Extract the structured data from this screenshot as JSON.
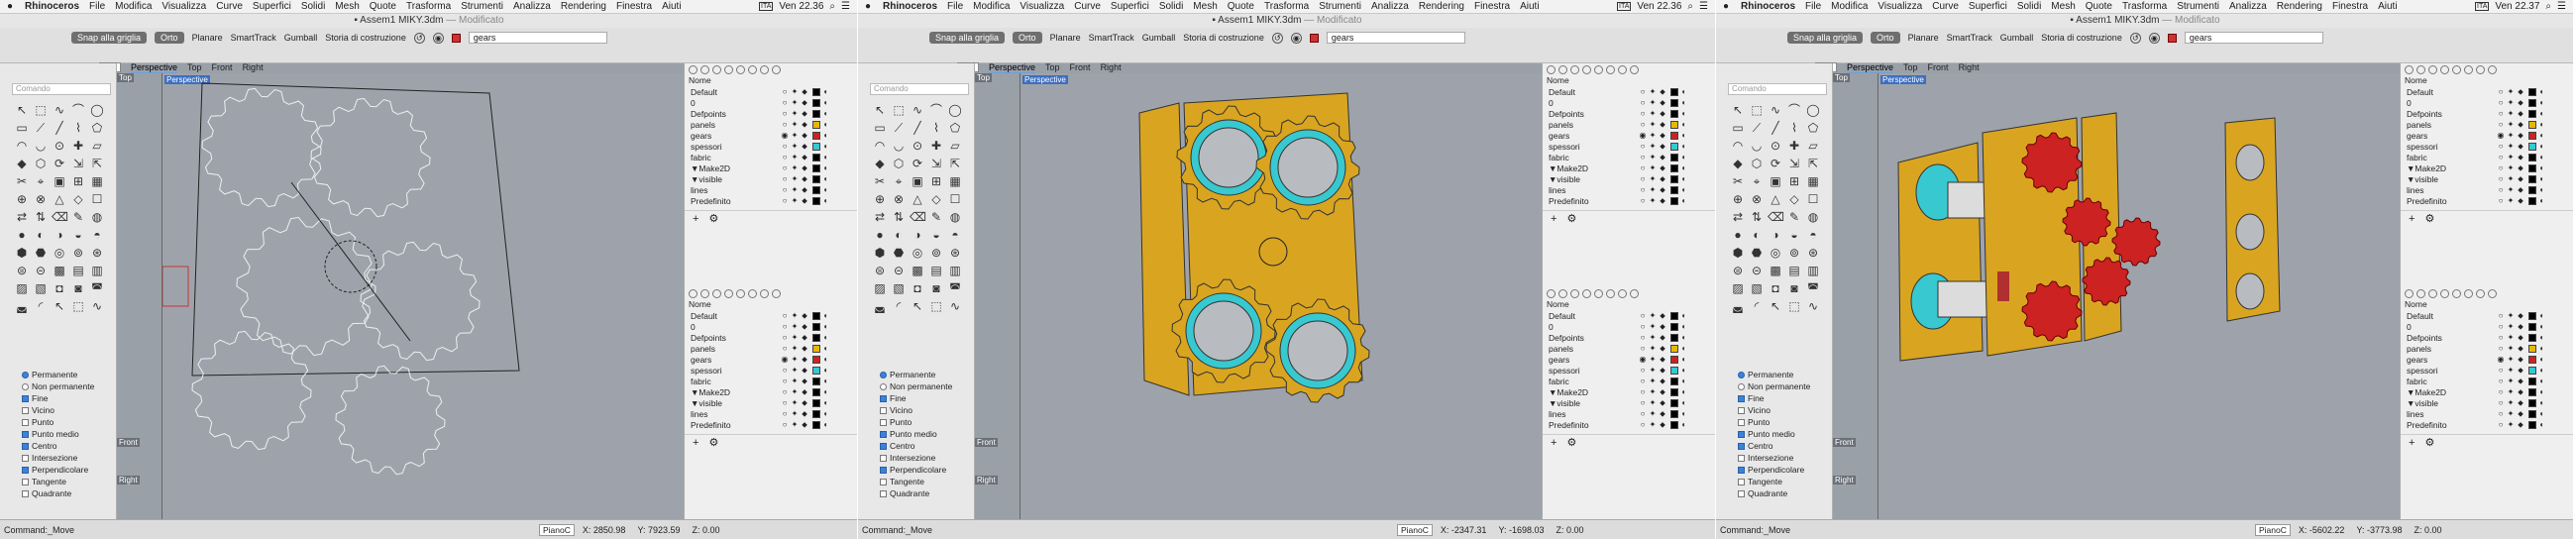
{
  "menubar": {
    "apple": "",
    "items": [
      "Rhinoceros",
      "File",
      "Modifica",
      "Visualizza",
      "Curve",
      "Superfici",
      "Solidi",
      "Mesh",
      "Quote",
      "Trasforma",
      "Strumenti",
      "Analizza",
      "Rendering",
      "Finestra",
      "Aiuti"
    ],
    "input_badge": "ITA"
  },
  "toolbar": {
    "snap_grid": "Snap alla griglia",
    "orto": "Orto",
    "planare": "Planare",
    "smarttrack": "SmartTrack",
    "gumball": "Gumball",
    "storia": "Storia di costruzione",
    "layer_current": "gears"
  },
  "viewport_tabs": [
    "Perspective",
    "Top",
    "Front",
    "Right"
  ],
  "viewports": {
    "perspective": "Perspective",
    "top": "Top",
    "front": "Front",
    "right": "Right"
  },
  "command_placeholder": "Comando",
  "osnap": {
    "permanente": "Permanente",
    "non_permanente": "Non permanente",
    "items": [
      {
        "label": "Fine",
        "on": true
      },
      {
        "label": "Vicino",
        "on": false
      },
      {
        "label": "Punto",
        "on": false
      },
      {
        "label": "Punto medio",
        "on": true
      },
      {
        "label": "Centro",
        "on": true
      },
      {
        "label": "Intersezione",
        "on": false
      },
      {
        "label": "Perpendicolare",
        "on": true
      },
      {
        "label": "Tangente",
        "on": false
      },
      {
        "label": "Quadrante",
        "on": false
      }
    ]
  },
  "layers": {
    "header": "Nome",
    "rows": [
      {
        "name": "Default",
        "color": "#000000"
      },
      {
        "name": "0",
        "color": "#000000"
      },
      {
        "name": "Defpoints",
        "color": "#000000"
      },
      {
        "name": "panels",
        "color": "#e8b800"
      },
      {
        "name": "gears",
        "color": "#cc2222"
      },
      {
        "name": "spessori",
        "color": "#38c8d0"
      },
      {
        "name": "fabric",
        "color": "#000000"
      },
      {
        "name": "▼Make2D",
        "color": "#000000"
      },
      {
        "name": "▼visible",
        "color": "#000000"
      },
      {
        "name": "lines",
        "color": "#000000"
      },
      {
        "name": "Predefinito",
        "color": "#000000"
      }
    ],
    "footer_add": "+",
    "footer_gear": "⚙"
  },
  "shots": [
    {
      "title": "Assem1 MIKY.3dm",
      "modified": "— Modificato",
      "time": "Ven 22.36",
      "command": "Command:_Move",
      "plane": "PianoC",
      "x": "X: 2850.98",
      "y": "Y: 7923.59",
      "z": "Z: 0.00"
    },
    {
      "title": "Assem1 MIKY.3dm",
      "modified": "— Modificato",
      "time": "Ven 22.36",
      "command": "Command:_Move",
      "plane": "PianoC",
      "x": "X: -2347.31",
      "y": "Y: -1698.03",
      "z": "Z: 0.00"
    },
    {
      "title": "Assem1 MIKY.3dm",
      "modified": "— Modificato",
      "time": "Ven 22.37",
      "command": "Command:_Move",
      "plane": "PianoC",
      "x": "X: -5602.22",
      "y": "Y: -3773.98",
      "z": "Z: 0.00"
    }
  ],
  "colors": {
    "panel": "#d9a520",
    "ring": "#38c8d0",
    "gear": "#cc2222",
    "viewport": "#9ea3ab"
  },
  "icons": [
    "apple-icon",
    "search-icon",
    "history-icon",
    "layer-color-icon",
    "select-tool-icon"
  ]
}
